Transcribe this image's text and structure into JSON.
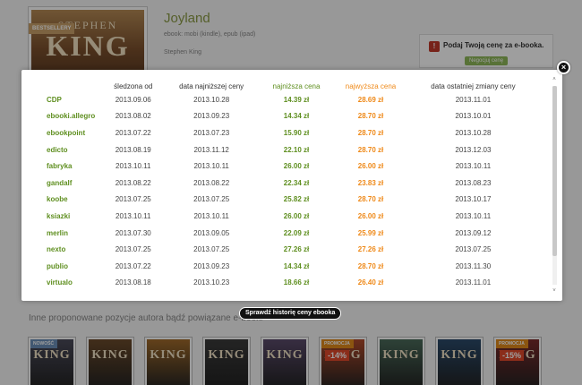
{
  "book": {
    "title": "Joyland",
    "formats": "ebook: mobi (kindle), epub (ipad)",
    "author": "Stephen King",
    "cover_author": "STEPHEN",
    "cover_title": "KING",
    "badge": "BESTSELLERY"
  },
  "price_box": {
    "text": "Podaj Twoją cenę za e-booka.",
    "button": "Negocjuj cenę"
  },
  "related": {
    "heading": "Inne proponowane pozycje autora bądź powiązane e-booki",
    "items": [
      {
        "title": "KING",
        "tag": "NOWOŚĆ",
        "tag_color": "#6b8fb8",
        "color": "#4a4a5a"
      },
      {
        "title": "KING",
        "color": "#6a4a2a"
      },
      {
        "title": "KING",
        "color": "#a06a2a"
      },
      {
        "title": "KING",
        "color": "#3a3a3a"
      },
      {
        "title": "KING",
        "color": "#5a4a6a"
      },
      {
        "title": "KING",
        "tag": "PROMOCJA",
        "tag_color": "#e08a1a",
        "discount": "-14%",
        "color": "#b04a2a"
      },
      {
        "title": "KING",
        "color": "#4a6a5a"
      },
      {
        "title": "KING",
        "color": "#2a4a6a"
      },
      {
        "title": "KING",
        "tag": "PROMOCJA",
        "tag_color": "#e08a1a",
        "discount": "-15%",
        "color": "#7a2a2a"
      }
    ]
  },
  "history_table": {
    "headers": {
      "store": "",
      "tracked_since": "śledzona od",
      "lowest_date": "data najniższej ceny",
      "lowest": "najniższa cena",
      "highest": "najwyższa cena",
      "last_change": "data ostatniej zmiany ceny"
    },
    "rows": [
      {
        "store": "CDP",
        "tracked_since": "2013.09.06",
        "lowest_date": "2013.10.28",
        "lowest": "14.39 zł",
        "highest": "28.69 zł",
        "last_change": "2013.11.01"
      },
      {
        "store": "ebooki.allegro",
        "tracked_since": "2013.08.02",
        "lowest_date": "2013.09.23",
        "lowest": "14.34 zł",
        "highest": "28.70 zł",
        "last_change": "2013.10.01"
      },
      {
        "store": "ebookpoint",
        "tracked_since": "2013.07.22",
        "lowest_date": "2013.07.23",
        "lowest": "15.90 zł",
        "highest": "28.70 zł",
        "last_change": "2013.10.28"
      },
      {
        "store": "edicto",
        "tracked_since": "2013.08.19",
        "lowest_date": "2013.11.12",
        "lowest": "22.10 zł",
        "highest": "28.70 zł",
        "last_change": "2013.12.03"
      },
      {
        "store": "fabryka",
        "tracked_since": "2013.10.11",
        "lowest_date": "2013.10.11",
        "lowest": "26.00 zł",
        "highest": "26.00 zł",
        "last_change": "2013.10.11"
      },
      {
        "store": "gandalf",
        "tracked_since": "2013.08.22",
        "lowest_date": "2013.08.22",
        "lowest": "22.34 zł",
        "highest": "23.83 zł",
        "last_change": "2013.08.23"
      },
      {
        "store": "koobe",
        "tracked_since": "2013.07.25",
        "lowest_date": "2013.07.25",
        "lowest": "25.82 zł",
        "highest": "28.70 zł",
        "last_change": "2013.10.17"
      },
      {
        "store": "ksiazki",
        "tracked_since": "2013.10.11",
        "lowest_date": "2013.10.11",
        "lowest": "26.00 zł",
        "highest": "26.00 zł",
        "last_change": "2013.10.11"
      },
      {
        "store": "merlin",
        "tracked_since": "2013.07.30",
        "lowest_date": "2013.09.05",
        "lowest": "22.09 zł",
        "highest": "25.99 zł",
        "last_change": "2013.09.12"
      },
      {
        "store": "nexto",
        "tracked_since": "2013.07.25",
        "lowest_date": "2013.07.25",
        "lowest": "27.26 zł",
        "highest": "27.26 zł",
        "last_change": "2013.07.25"
      },
      {
        "store": "publio",
        "tracked_since": "2013.07.22",
        "lowest_date": "2013.09.23",
        "lowest": "14.34 zł",
        "highest": "28.70 zł",
        "last_change": "2013.11.30"
      },
      {
        "store": "virtualo",
        "tracked_since": "2013.08.18",
        "lowest_date": "2013.10.23",
        "lowest": "18.66 zł",
        "highest": "26.40 zł",
        "last_change": "2013.11.01"
      }
    ]
  },
  "modal": {
    "close_label": "×",
    "history_button": "Sprawdź historię ceny ebooka",
    "scroll_up": "˄",
    "scroll_down": "˅"
  },
  "colors": {
    "lowest": "#5f8f20",
    "highest": "#ef8a1a",
    "store": "#5f8f20"
  }
}
